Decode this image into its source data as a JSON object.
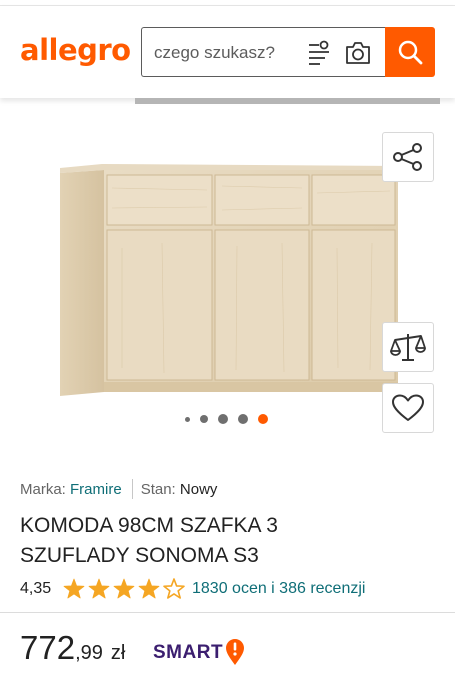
{
  "colors": {
    "brand": "#ff5a00",
    "link": "#0f6e77",
    "smart": "#3b1e6f",
    "dot_active": "#ff5a00",
    "dot_inactive": "#6f6f6f",
    "star": "#f5a623"
  },
  "header": {
    "logo": "allegro",
    "search": {
      "placeholder": "czego szukasz?",
      "icons": [
        "sort-icon",
        "camera-icon"
      ],
      "button_icon": "search-icon"
    }
  },
  "product": {
    "image_alt": "komoda sonoma",
    "actions": [
      "share-icon",
      "compare-scale-icon",
      "heart-icon"
    ],
    "gallery": {
      "total": 5,
      "active": 5
    },
    "meta": {
      "brand_label": "Marka:",
      "brand_value": "Framire",
      "condition_label": "Stan:",
      "condition_value": "Nowy"
    },
    "title_line1": "KOMODA 98CM SZAFKA 3",
    "title_line2": "SZUFLADY SONOMA S3",
    "rating": {
      "value_text": "4,35",
      "stars_filled": 4,
      "stars_total": 5,
      "reviews_text": "1830 ocen i 386 recenzji"
    },
    "price": {
      "integer": "772",
      "decimal": ",99",
      "currency": "zł",
      "smart_label": "SMART"
    }
  }
}
